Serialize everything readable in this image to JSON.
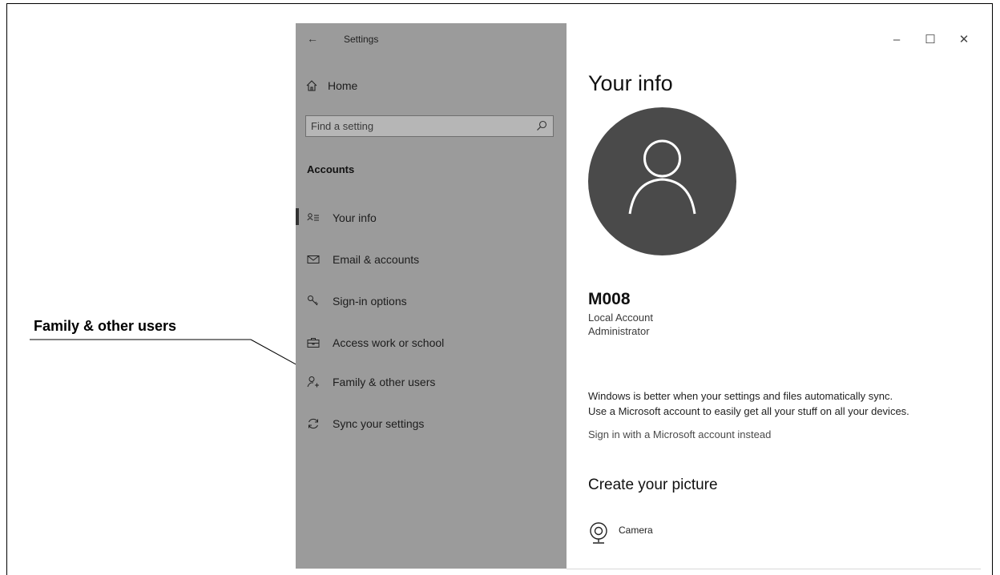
{
  "callout": {
    "label": "Family & other users"
  },
  "window": {
    "title": "Settings",
    "controls": {
      "minimize": "–",
      "maximize": "☐",
      "close": "✕"
    }
  },
  "sidebar": {
    "home_label": "Home",
    "search": {
      "placeholder": "Find a setting"
    },
    "section_heading": "Accounts",
    "items": [
      {
        "label": "Your info",
        "icon": "your-info-icon",
        "active": true
      },
      {
        "label": "Email & accounts",
        "icon": "mail-icon",
        "active": false
      },
      {
        "label": "Sign-in options",
        "icon": "key-icon",
        "active": false
      },
      {
        "label": "Access work or school",
        "icon": "briefcase-icon",
        "active": false
      },
      {
        "label": "Family & other users",
        "icon": "add-person-icon",
        "active": false
      },
      {
        "label": "Sync your settings",
        "icon": "sync-icon",
        "active": false
      }
    ]
  },
  "content": {
    "title": "Your info",
    "user": {
      "name": "M008",
      "account_type": "Local Account",
      "role": "Administrator"
    },
    "sync_message": [
      "Windows is better when your settings and files automatically sync.",
      "Use a Microsoft account to easily get all your stuff on all your devices."
    ],
    "signin_link": "Sign in with a Microsoft account instead",
    "picture_heading": "Create your picture",
    "camera_label": "Camera"
  },
  "colors": {
    "sidebar_bg": "#9b9b9b",
    "avatar_bg": "#4a4a4a",
    "content_bg": "#ffffff"
  }
}
